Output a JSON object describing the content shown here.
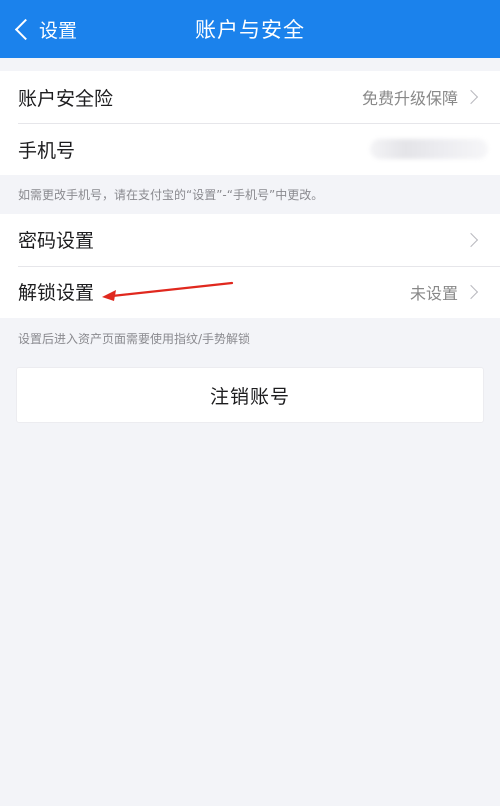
{
  "nav": {
    "back_label": "设置",
    "title": "账户与安全"
  },
  "group1": {
    "items": [
      {
        "label": "账户安全险",
        "value": "免费升级保障"
      },
      {
        "label": "手机号",
        "value": ""
      }
    ]
  },
  "note1": "如需更改手机号，请在支付宝的“设置”-“手机号”中更改。",
  "group2": {
    "items": [
      {
        "label": "密码设置",
        "value": ""
      },
      {
        "label": "解锁设置",
        "value": "未设置"
      }
    ]
  },
  "note2": "设置后进入资产页面需要使用指纹/手势解锁",
  "cancel_button": "注销账号",
  "colors": {
    "nav_bg": "#1b82ec",
    "page_bg": "#f3f4f8",
    "annotation_arrow": "#e0281e"
  }
}
